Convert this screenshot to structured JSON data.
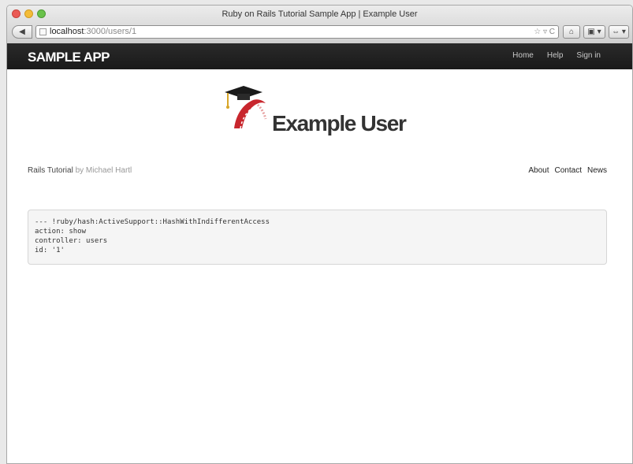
{
  "window": {
    "title": "Ruby on Rails Tutorial Sample App | Example User"
  },
  "toolbar": {
    "url_host": "localhost",
    "url_rest": ":3000/users/1",
    "back_glyph": "◀",
    "url_icons": "☆ ▿ C",
    "home_glyph": "⌂",
    "tab_glyph": "▣ ▾",
    "extra_glyph": "⇔ ▾"
  },
  "navbar": {
    "brand": "SAMPLE APP",
    "links": [
      "Home",
      "Help",
      "Sign in"
    ]
  },
  "header": {
    "title": "Example User"
  },
  "byline": {
    "link": "Rails Tutorial",
    "by": "by Michael Hartl"
  },
  "footer": {
    "links": [
      "About",
      "Contact",
      "News"
    ]
  },
  "debug": {
    "lines": [
      "--- !ruby/hash:ActiveSupport::HashWithIndifferentAccess",
      "action: show",
      "controller: users",
      "id: '1'"
    ]
  },
  "colors": {
    "navbar": "#222222",
    "logo_red": "#c8262d",
    "logo_cap": "#1a1a1a"
  }
}
